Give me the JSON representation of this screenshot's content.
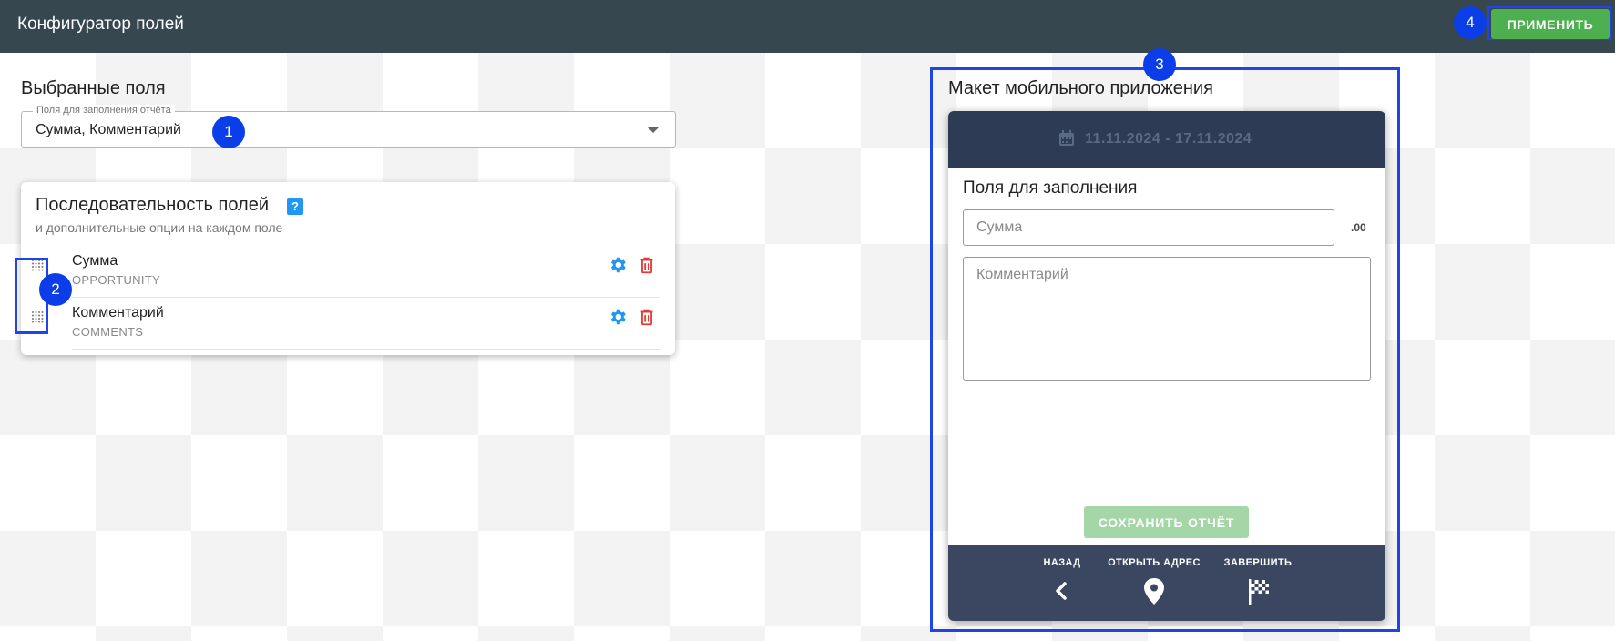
{
  "header": {
    "title": "Конфигуратор полей",
    "apply_label": "ПРИМЕНИТЬ"
  },
  "markers": [
    "1",
    "2",
    "3",
    "4"
  ],
  "selected_fields": {
    "title": "Выбранные поля",
    "select_legend": "Поля для заполнения отчёта",
    "select_value": "Сумма, Комментарий"
  },
  "sequence": {
    "title": "Последовательность полей",
    "help": "?",
    "subtitle": "и дополнительные опции на каждом поле",
    "items": [
      {
        "name": "Сумма",
        "code": "OPPORTUNITY"
      },
      {
        "name": "Комментарий",
        "code": "COMMENTS"
      }
    ]
  },
  "mobile": {
    "title": "Макет мобильного приложения",
    "date_range": "11.11.2024 - 17.11.2024",
    "fill_title": "Поля для заполнения",
    "sum_placeholder": "Сумма",
    "sum_suffix": ".00",
    "comment_placeholder": "Комментарий",
    "save_label": "СОХРАНИТЬ ОТЧЁТ",
    "nav": [
      {
        "label": "НАЗАД",
        "icon": "chevron-left-icon"
      },
      {
        "label": "ОТКРЫТЬ АДРЕС",
        "icon": "map-pin-icon"
      },
      {
        "label": "ЗАВЕРШИТЬ",
        "icon": "checkered-flag-icon"
      }
    ]
  },
  "colors": {
    "topbar": "#36474f",
    "apply": "#4caf50",
    "marker": "#0b3ee8",
    "gear": "#2196f3",
    "trash": "#e53935",
    "phone_header": "#2e3b55",
    "phone_footer": "#3b4761"
  }
}
